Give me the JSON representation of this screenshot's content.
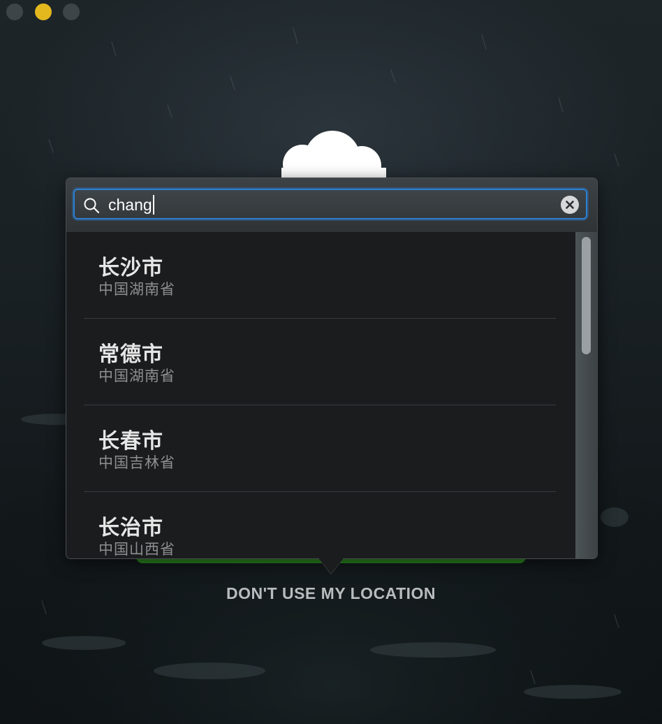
{
  "window": {
    "controls": [
      "close",
      "minimize",
      "zoom"
    ]
  },
  "search": {
    "query": "chang",
    "icon": "search-icon",
    "clear_icon": "clear-icon"
  },
  "results": [
    {
      "name": "长沙市",
      "region": "中国湖南省"
    },
    {
      "name": "常德市",
      "region": "中国湖南省"
    },
    {
      "name": "长春市",
      "region": "中国吉林省"
    },
    {
      "name": "长治市",
      "region": "中国山西省"
    }
  ],
  "footer": {
    "location_link": "DON'T USE MY LOCATION"
  },
  "colors": {
    "accent": "#2d7ed0",
    "minimize": "#e3b81f",
    "green_bar": "#2c8a1f"
  }
}
